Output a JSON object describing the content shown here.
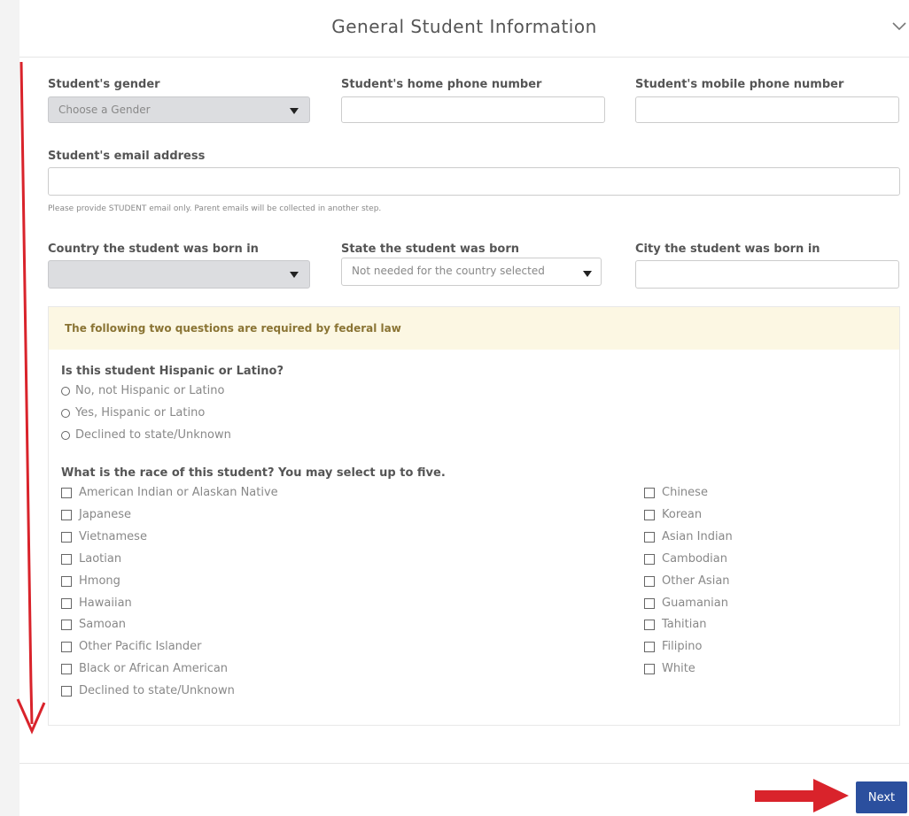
{
  "header": {
    "title": "General Student Information",
    "toggle_icon": "chevron-down-icon"
  },
  "fields": {
    "gender": {
      "label": "Student's gender",
      "value": "Choose a Gender"
    },
    "home_phone": {
      "label": "Student's home phone number",
      "value": ""
    },
    "mobile_phone": {
      "label": "Student's mobile phone number",
      "value": ""
    },
    "email": {
      "label": "Student's email address",
      "value": "",
      "help": "Please provide STUDENT email only. Parent emails will be collected in another step."
    },
    "birth_country": {
      "label": "Country the student was born in",
      "value": ""
    },
    "birth_state": {
      "label": "State the student was born",
      "value": "Not needed for the country selected"
    },
    "birth_city": {
      "label": "City the student was born in",
      "value": ""
    }
  },
  "federal": {
    "banner": "The following two questions are required by federal law",
    "hispanic": {
      "question": "Is this student Hispanic or Latino?",
      "options": [
        "No, not Hispanic or Latino",
        "Yes, Hispanic or Latino",
        "Declined to state/Unknown"
      ]
    },
    "race": {
      "question": "What is the race of this student? You may select up to five.",
      "col1": [
        "American Indian or Alaskan Native",
        "Japanese",
        "Vietnamese",
        "Laotian",
        "Hmong",
        "Hawaiian",
        "Samoan",
        "Other Pacific Islander",
        "Black or African American",
        "Declined to state/Unknown"
      ],
      "col2": [
        "Chinese",
        "Korean",
        "Asian Indian",
        "Cambodian",
        "Other Asian",
        "Guamanian",
        "Tahitian",
        "Filipino",
        "White"
      ]
    }
  },
  "footer": {
    "next_label": "Next"
  },
  "colors": {
    "primary": "#2b4f9e",
    "annotation": "#d9232b",
    "banner_bg": "#fcf7e3"
  }
}
